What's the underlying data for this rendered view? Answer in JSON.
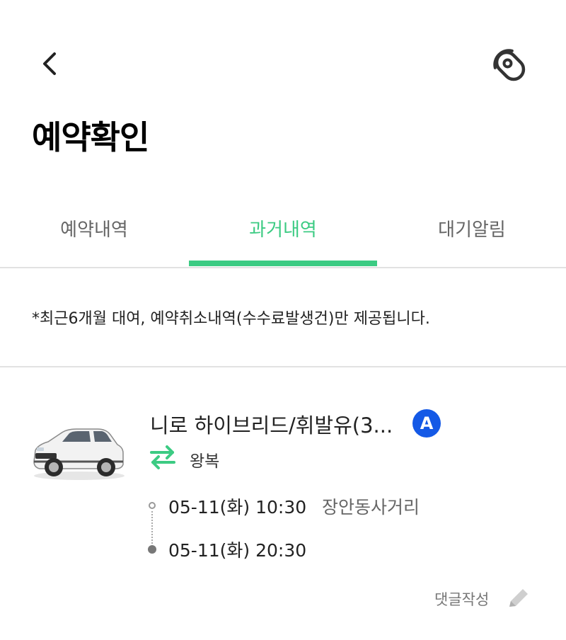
{
  "header": {
    "back_icon": "chevron-left-icon",
    "key_icon": "car-key-icon",
    "title": "예약확인"
  },
  "tabs": [
    {
      "label": "예약내역",
      "active": false
    },
    {
      "label": "과거내역",
      "active": true
    },
    {
      "label": "대기알림",
      "active": false
    }
  ],
  "colors": {
    "accent": "#3ccb83",
    "badge": "#1459e6"
  },
  "notice": "*최근6개월 대여, 예약취소내역(수수료발생건)만 제공됩니다.",
  "reservation": {
    "car_name": "니로 하이브리드/휘발유(3...",
    "grade_badge": "A",
    "trip_type_icon": "swap-arrows-icon",
    "trip_type": "왕복",
    "pickup_time": "05-11(화) 10:30",
    "pickup_place": "장안동사거리",
    "return_time": "05-11(화) 20:30",
    "review_label": "댓글작성",
    "review_icon": "pencil-icon"
  }
}
